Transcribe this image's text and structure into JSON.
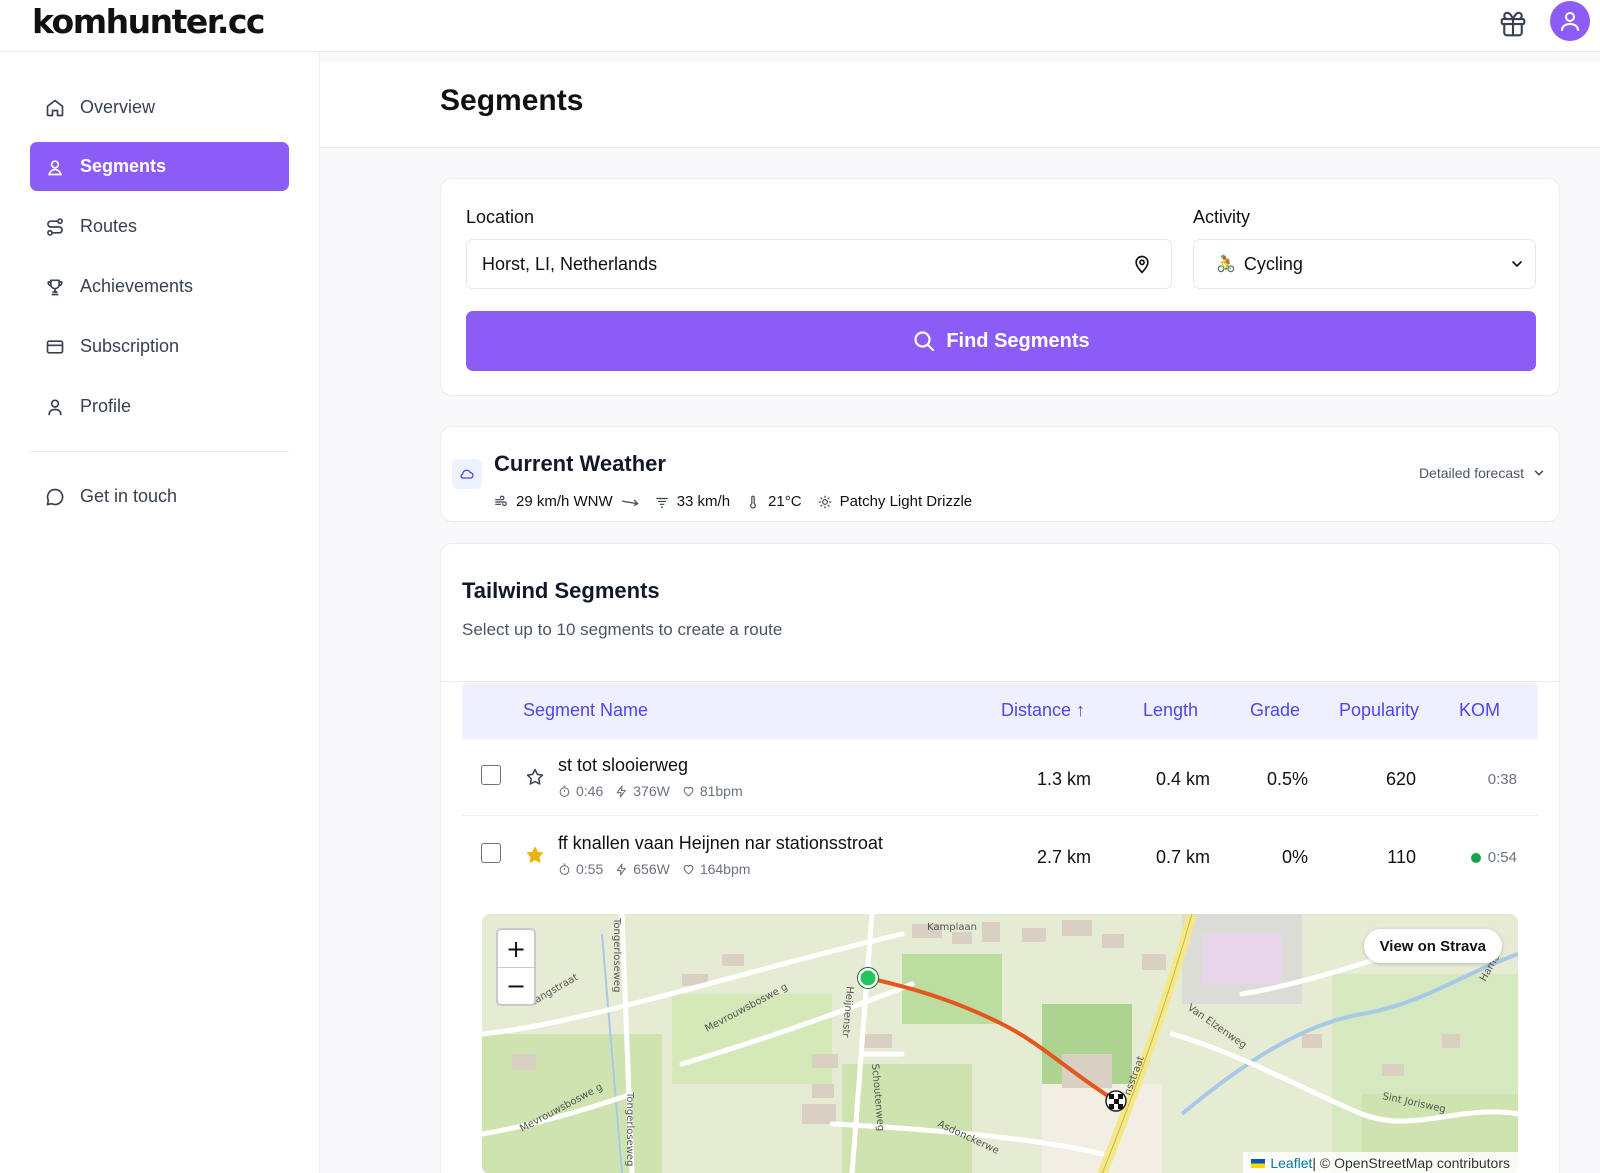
{
  "app": {
    "logo": "komhunter.cc",
    "accent": "#8b5cf6"
  },
  "sidebar": {
    "items": [
      {
        "label": "Overview",
        "icon": "home-icon"
      },
      {
        "label": "Segments",
        "icon": "segments-icon",
        "active": true
      },
      {
        "label": "Routes",
        "icon": "routes-icon"
      },
      {
        "label": "Achievements",
        "icon": "trophy-icon"
      },
      {
        "label": "Subscription",
        "icon": "card-icon"
      },
      {
        "label": "Profile",
        "icon": "user-icon"
      }
    ],
    "contact": {
      "label": "Get in touch",
      "icon": "chat-icon"
    }
  },
  "page": {
    "title": "Segments"
  },
  "search": {
    "location_label": "Location",
    "location_value": "Horst, LI, Netherlands",
    "activity_label": "Activity",
    "activity_value": "Cycling",
    "activity_icon": "🚴",
    "find_label": "Find Segments"
  },
  "weather": {
    "title": "Current Weather",
    "wind": "29 km/h WNW",
    "gust": "33 km/h",
    "temp": "21°C",
    "condition": "Patchy Light Drizzle",
    "forecast_label": "Detailed forecast"
  },
  "segments": {
    "title": "Tailwind Segments",
    "subtitle": "Select up to 10 segments to create a route",
    "columns": {
      "name": "Segment Name",
      "distance": "Distance ↑",
      "length": "Length",
      "grade": "Grade",
      "popularity": "Popularity",
      "kom": "KOM"
    },
    "rows": [
      {
        "name": "st tot slooierweg",
        "time": "0:46",
        "power": "376W",
        "hr": "81bpm",
        "distance": "1.3 km",
        "length": "0.4 km",
        "grade": "0.5%",
        "popularity": "620",
        "kom": "0:38",
        "starred": false,
        "kom_held": false
      },
      {
        "name": "ff knallen vaan Heijnen nar stationsstroat",
        "time": "0:55",
        "power": "656W",
        "hr": "164bpm",
        "distance": "2.7 km",
        "length": "0.7 km",
        "grade": "0%",
        "popularity": "110",
        "kom": "0:54",
        "starred": true,
        "kom_held": true
      }
    ]
  },
  "map": {
    "zoom_in": "+",
    "zoom_out": "−",
    "strava_button": "View on Strava",
    "attribution_leaflet": "Leaflet",
    "attribution_rest": " | © OpenStreetMap contributors",
    "street_labels": [
      "Kamplaan",
      "Tongerloseweg",
      "Langstraat",
      "Mevrouwsboswe g",
      "Heijnenstr",
      "Schoutenweg",
      "Van Elzenweg",
      "Sint Jorisweg",
      "Asdonckerwe",
      "Mevrouwsboswe g",
      "Tongerloseweg",
      "nsstraat",
      "Hame"
    ]
  }
}
